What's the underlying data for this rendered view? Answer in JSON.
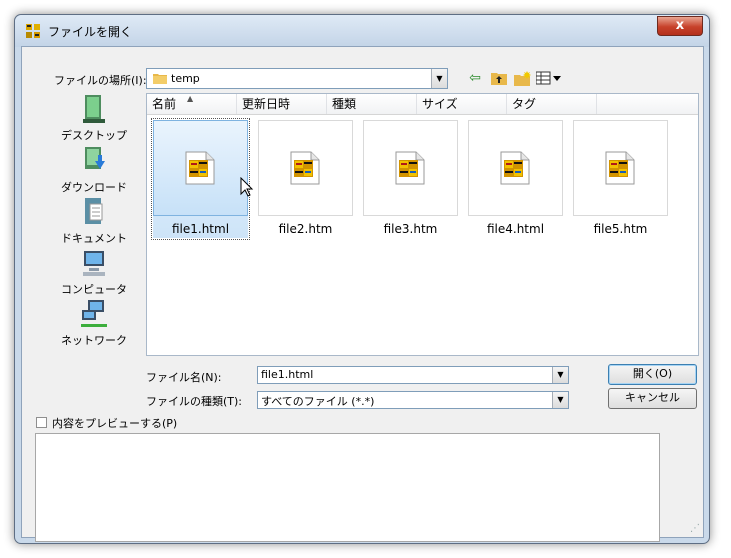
{
  "window": {
    "title": "ファイルを開く",
    "close_label": "x"
  },
  "toolbar": {
    "lookin_label": "ファイルの場所(I):",
    "lookin_value": "temp",
    "back_icon": "back-arrow-icon",
    "up_icon": "up-folder-icon",
    "new_folder_icon": "new-folder-icon",
    "view_icon": "view-menu-icon"
  },
  "places": [
    {
      "label": "デスクトップ",
      "icon": "desktop-icon"
    },
    {
      "label": "ダウンロード",
      "icon": "downloads-icon"
    },
    {
      "label": "ドキュメント",
      "icon": "documents-icon"
    },
    {
      "label": "コンピュータ",
      "icon": "computer-icon"
    },
    {
      "label": "ネットワーク",
      "icon": "network-icon"
    }
  ],
  "columns": [
    "名前",
    "更新日時",
    "種類",
    "サイズ",
    "タグ"
  ],
  "files": [
    {
      "name": "file1.html",
      "selected": true
    },
    {
      "name": "file2.htm",
      "selected": false
    },
    {
      "name": "file3.htm",
      "selected": false
    },
    {
      "name": "file4.html",
      "selected": false
    },
    {
      "name": "file5.htm",
      "selected": false
    }
  ],
  "form": {
    "filename_label": "ファイル名(N):",
    "filename_value": "file1.html",
    "filetype_label": "ファイルの種類(T):",
    "filetype_value": "すべてのファイル (*.*)",
    "open_label": "開く(O)",
    "cancel_label": "キャンセル"
  },
  "preview": {
    "checkbox_label": "内容をプレビューする(P)",
    "checked": false
  },
  "colors": {
    "frame": "#c9d9ea",
    "selection": "#cde4f8",
    "close": "#c7412a"
  }
}
